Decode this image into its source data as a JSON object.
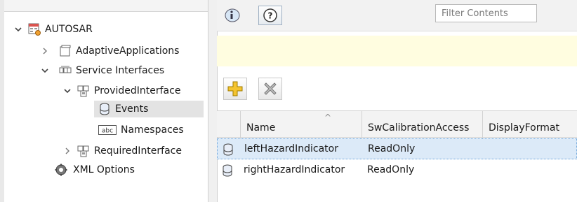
{
  "tree": {
    "root": {
      "label": "AUTOSAR"
    },
    "items": [
      {
        "label": "AdaptiveApplications"
      },
      {
        "label": "Service Interfaces"
      },
      {
        "label": "ProvidedInterface"
      },
      {
        "label": "Events"
      },
      {
        "label": "Namespaces"
      },
      {
        "label": "RequiredInterface"
      },
      {
        "label": "XML Options"
      }
    ]
  },
  "filter": {
    "placeholder": "Filter Contents"
  },
  "toolbar": {
    "add_icon": "add-icon",
    "delete_icon": "delete-icon"
  },
  "info_bar": {
    "info_icon": "info-icon",
    "help_label": "?"
  },
  "table": {
    "columns": [
      "Name",
      "SwCalibrationAccess",
      "DisplayFormat"
    ],
    "rows": [
      {
        "name": "leftHazardIndicator",
        "access": "ReadOnly",
        "format": ""
      },
      {
        "name": "rightHazardIndicator",
        "access": "ReadOnly",
        "format": ""
      }
    ]
  },
  "colors": {
    "selection": "#dceaf8",
    "info_background": "#fffde0",
    "tree_selection": "#e3e3e3"
  }
}
